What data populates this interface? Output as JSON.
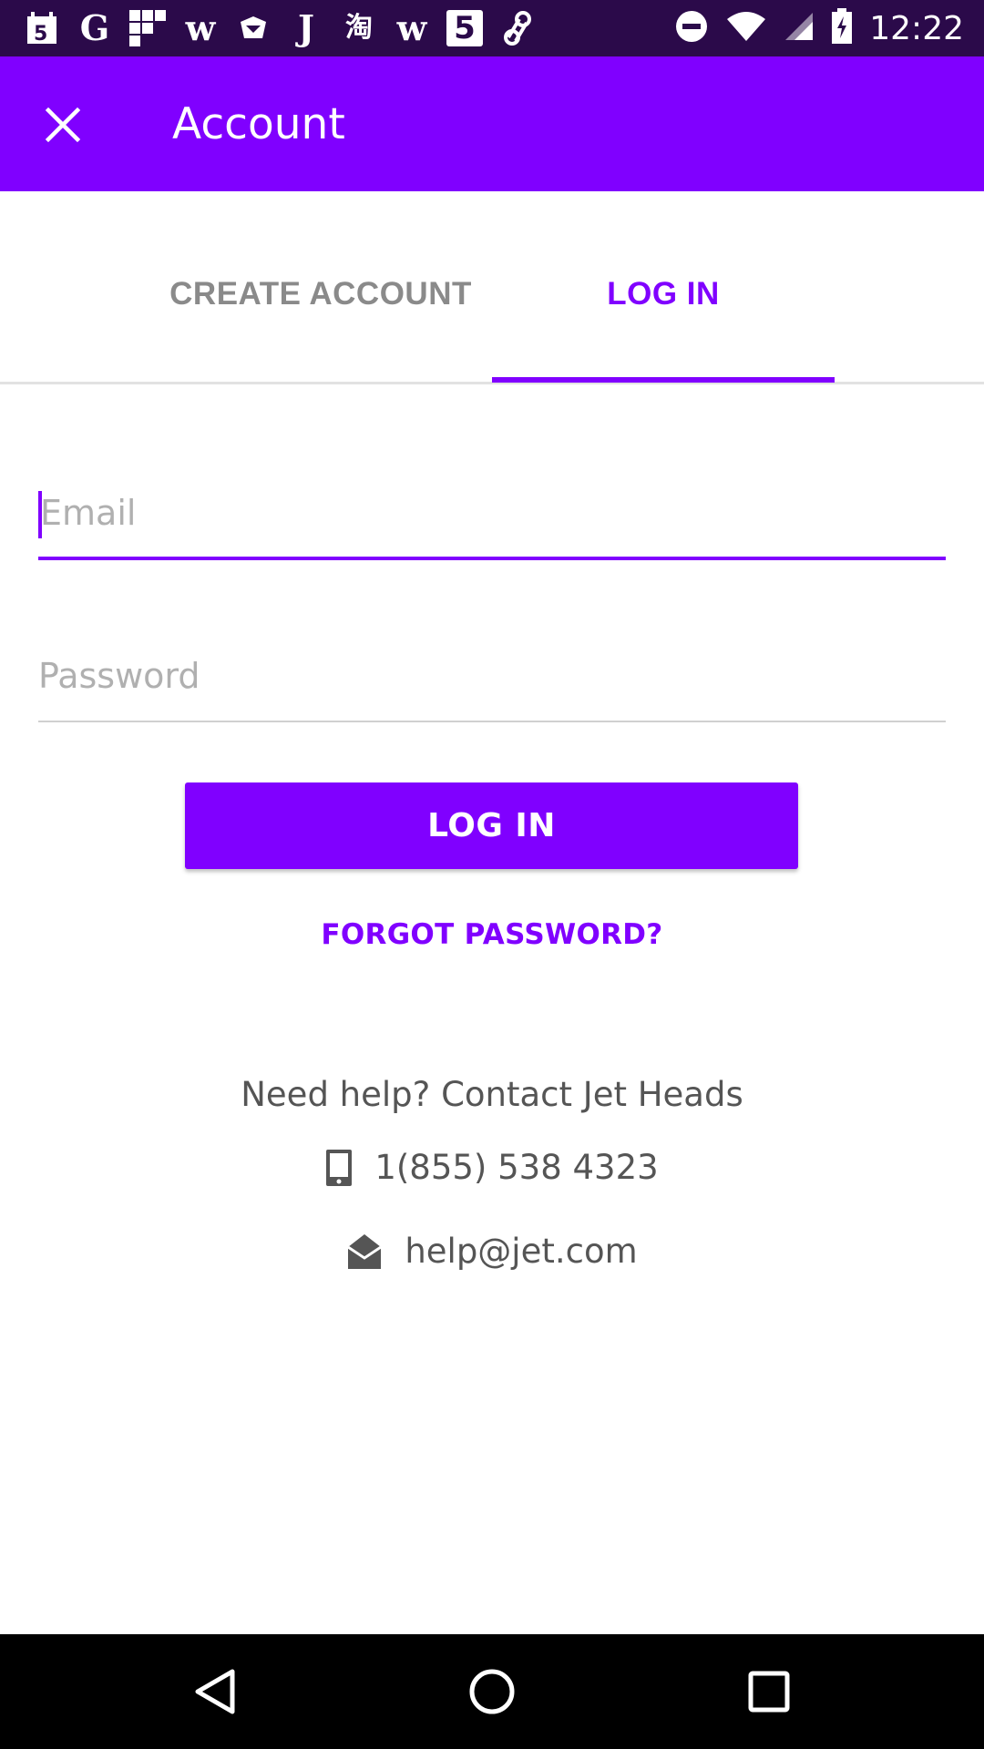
{
  "status_bar": {
    "time": "12:22",
    "notification_icons": [
      "calendar-icon",
      "G",
      "grid-icon",
      "w",
      "cube-icon",
      "J",
      "淘",
      "w",
      "5",
      "link-icon"
    ],
    "icons": [
      "do-not-disturb-icon",
      "wifi-icon",
      "signal-icon",
      "battery-icon"
    ]
  },
  "app_bar": {
    "title": "Account",
    "close_icon": "close-icon",
    "color": "#8000ff"
  },
  "tabs": [
    {
      "label": "CREATE ACCOUNT",
      "selected": false
    },
    {
      "label": "LOG IN",
      "selected": true
    }
  ],
  "form": {
    "email": {
      "placeholder": "Email",
      "value": ""
    },
    "password": {
      "placeholder": "Password",
      "value": ""
    },
    "login_button": "LOG IN",
    "forgot_password": "FORGOT PASSWORD?"
  },
  "help": {
    "text": "Need help? Contact Jet Heads",
    "phone": "1(855) 538 4323",
    "email": "help@jet.com"
  },
  "nav_bar": {
    "icons": [
      "back-icon",
      "home-icon",
      "recents-icon"
    ]
  }
}
